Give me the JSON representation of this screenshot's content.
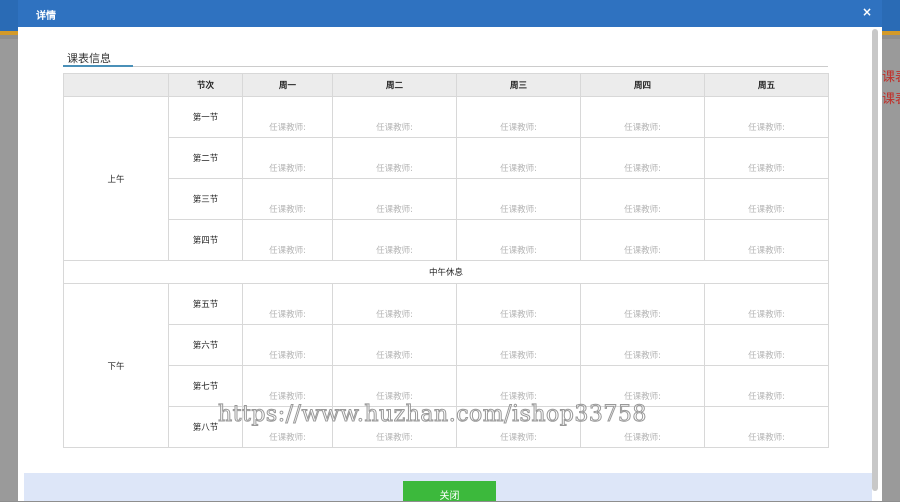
{
  "background": {
    "side_text": [
      "课表",
      "课表"
    ]
  },
  "dialog": {
    "title": "详情",
    "close": "×",
    "section_title": "课表信息",
    "close_button": "关闭"
  },
  "table": {
    "headers": [
      "",
      "节次",
      "周一",
      "周二",
      "周三",
      "周四",
      "周五"
    ],
    "morning_label": "上午",
    "afternoon_label": "下午",
    "break_label": "中午休息",
    "morning_periods": [
      "第一节",
      "第二节",
      "第三节",
      "第四节"
    ],
    "afternoon_periods": [
      "第五节",
      "第六节",
      "第七节",
      "第八节"
    ],
    "cell_text": "任课教师:"
  },
  "watermark": "https://www.huzhan.com/ishop33758"
}
